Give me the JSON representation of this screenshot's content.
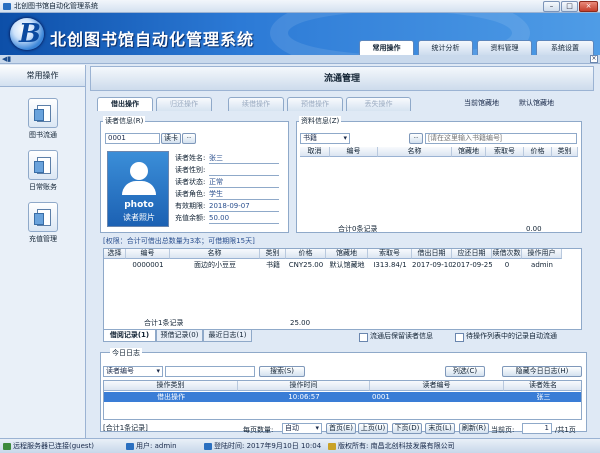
{
  "window": {
    "title": "北创图书馆自动化管理系统",
    "min": "–",
    "max": "□",
    "close": "×"
  },
  "header": {
    "logo_letter": "B",
    "app_title": "北创图书馆自动化管理系统",
    "tabs": [
      "常用操作",
      "统计分析",
      "资料管理",
      "系统设置"
    ]
  },
  "left_panel": {
    "title": "常用操作",
    "items": [
      "图书流通",
      "日常账务",
      "充值管理"
    ]
  },
  "main": {
    "title": "流通管理",
    "op_tabs": [
      "借出操作",
      "归还操作",
      "续借操作",
      "预借操作",
      "丢失操作"
    ],
    "library_label": "当前馆藏地",
    "library_value": "默认馆藏地",
    "reader": {
      "group_title": "读者信息(R)",
      "card_no": "0001",
      "card_type": "读卡",
      "more": "··",
      "photo_text": "photo",
      "photo_sub": "读者照片",
      "fields": [
        {
          "label": "读者姓名:",
          "value": "张三"
        },
        {
          "label": "读者性别:",
          "value": ""
        },
        {
          "label": "读者状态:",
          "value": "正常"
        },
        {
          "label": "读者角色:",
          "value": "学生"
        },
        {
          "label": "有效期限:",
          "value": "2018-09-07"
        },
        {
          "label": "充值余额:",
          "value": "50.00"
        }
      ]
    },
    "material": {
      "group_title": "资料信息(Z)",
      "type": "书籍",
      "more": "··",
      "placeholder": "[请在这里输入书籍编号]",
      "columns": [
        "取消",
        "编号",
        "名称",
        "馆藏地",
        "索取号",
        "价格",
        "类别"
      ],
      "total_label": "合计0条记录",
      "total_value": "0.00"
    },
    "borrow_note": "[权限：合计可借出总数量为3本；可借期限15天]",
    "borrow_table": {
      "columns": [
        "选择",
        "编号",
        "名称",
        "类别",
        "价格",
        "馆藏地",
        "索取号",
        "借出日期",
        "应还日期",
        "续借次数",
        "操作用户"
      ],
      "rows": [
        [
          "",
          "0000001",
          "面边的小豆豆",
          "书籍",
          "CNY25.00",
          "默认馆藏地",
          "I313.84/1",
          "2017-09-10",
          "2017-09-25",
          "0",
          "admin"
        ]
      ],
      "total_label": "合计1条记录",
      "total_value": "25.00"
    },
    "bottom_tabs": [
      "借阅记录(1)",
      "预借记录(0)",
      "最近日志(1)"
    ],
    "check_retain": "流通后保留读者信息",
    "check_auto": "待操作列表中的记录自动流通",
    "log": {
      "group_title": "今日日志",
      "search_field": "读者编号",
      "search_btn": "搜索(S)",
      "column_btn": "列选(C)",
      "hide_btn": "隐藏今日日志(H)",
      "columns": [
        "操作类别",
        "操作时间",
        "读者编号",
        "读者姓名"
      ],
      "rows": [
        [
          "借出操作",
          "10:06:57",
          "0001",
          "张三"
        ]
      ],
      "count": "[合计1条记录]",
      "page_size_label": "每页数量:",
      "page_size": "自动",
      "first": "首页(E)",
      "prev": "上页(U)",
      "next": "下页(D)",
      "last": "末页(L)",
      "refresh": "刷新(R)",
      "current_label": "当前页:",
      "current_page": "1",
      "total_pages": "/共1页"
    }
  },
  "status": {
    "server": "远程服务器已连接(guest)",
    "user": "用户: admin",
    "login": "登陆时间: 2017年9月10日 10:04",
    "copyright": "版权所有: 南昌北创科技发展有限公司"
  }
}
